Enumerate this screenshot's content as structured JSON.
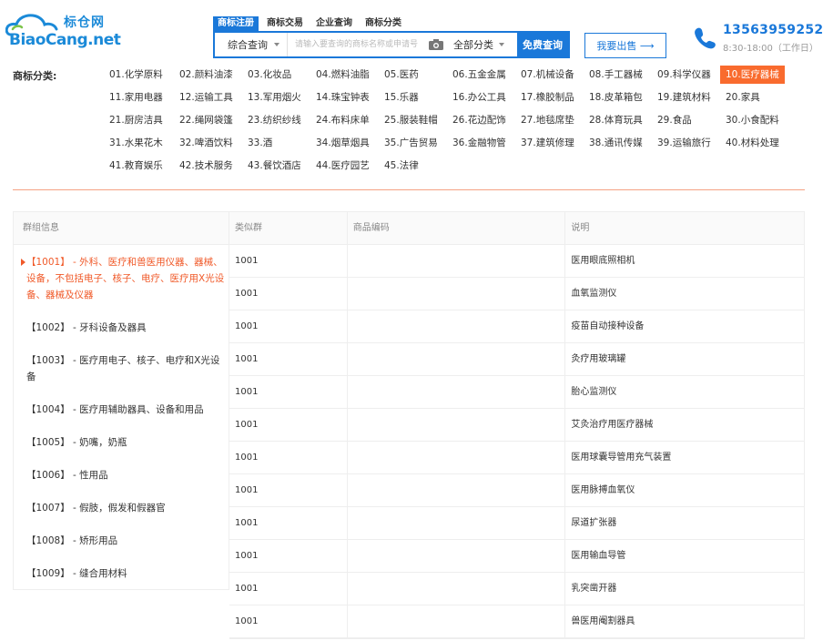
{
  "logo": {
    "cn": "标仓网",
    "en": "BiaoCang.net"
  },
  "search": {
    "tabs": [
      "商标注册",
      "商标交易",
      "企业查询",
      "商标分类"
    ],
    "type_label": "综合查询",
    "placeholder": "请输入要查询的商标名称或申请号",
    "category_label": "全部分类",
    "button_label": "免费查询"
  },
  "sell_button": "我要出售 ⟶",
  "contact": {
    "phone": "13563959252",
    "hours": "8:30-18:00（工作日）"
  },
  "categories": {
    "label": "商标分类:",
    "items": [
      "01.化学原料",
      "02.颜料油漆",
      "03.化妆品",
      "04.燃料油脂",
      "05.医药",
      "06.五金金属",
      "07.机械设备",
      "08.手工器械",
      "09.科学仪器",
      "10.医疗器械",
      "11.家用电器",
      "12.运输工具",
      "13.军用烟火",
      "14.珠宝钟表",
      "15.乐器",
      "16.办公工具",
      "17.橡胶制品",
      "18.皮革箱包",
      "19.建筑材料",
      "20.家具",
      "21.厨房洁具",
      "22.绳网袋篷",
      "23.纺织纱线",
      "24.布料床单",
      "25.服装鞋帽",
      "26.花边配饰",
      "27.地毯席垫",
      "28.体育玩具",
      "29.食品",
      "30.小食配料",
      "31.水果花木",
      "32.啤酒饮料",
      "33.酒",
      "34.烟草烟具",
      "35.广告贸易",
      "36.金融物管",
      "37.建筑修理",
      "38.通讯传媒",
      "39.运输旅行",
      "40.材料处理",
      "41.教育娱乐",
      "42.技术服务",
      "43.餐饮酒店",
      "44.医疗园艺",
      "45.法律"
    ],
    "active_index": 9
  },
  "group_panel": {
    "header": "群组信息",
    "items": [
      "【1001】 - 外科、医疗和兽医用仪器、器械、设备，不包括电子、核子、电疗、医疗用X光设备、器械及仪器",
      "【1002】 - 牙科设备及器具",
      "【1003】 - 医疗用电子、核子、电疗和X光设备",
      "【1004】 - 医疗用辅助器具、设备和用品",
      "【1005】 - 奶嘴，奶瓶",
      "【1006】 - 性用品",
      "【1007】 - 假肢，假发和假器官",
      "【1008】 - 矫形用品",
      "【1009】 - 缝合用材料"
    ],
    "active_index": 0
  },
  "table": {
    "headers": [
      "类似群",
      "商品编码",
      "说明"
    ],
    "rows": [
      [
        "1001",
        "",
        "医用眼底照相机"
      ],
      [
        "1001",
        "",
        "血氧监测仪"
      ],
      [
        "1001",
        "",
        "疫苗自动接种设备"
      ],
      [
        "1001",
        "",
        "灸疗用玻璃罐"
      ],
      [
        "1001",
        "",
        "胎心监测仪"
      ],
      [
        "1001",
        "",
        "艾灸治疗用医疗器械"
      ],
      [
        "1001",
        "",
        "医用球囊导管用充气装置"
      ],
      [
        "1001",
        "",
        "医用脉搏血氧仪"
      ],
      [
        "1001",
        "",
        "尿道扩张器"
      ],
      [
        "1001",
        "",
        "医用输血导管"
      ],
      [
        "1001",
        "",
        "乳突凿开器"
      ],
      [
        "1001",
        "",
        "兽医用阉割器具"
      ]
    ]
  },
  "colors": {
    "accent": "#1a78d9",
    "active": "#f96b2e",
    "active_text": "#f05a2a",
    "divider": "#f5a284"
  }
}
